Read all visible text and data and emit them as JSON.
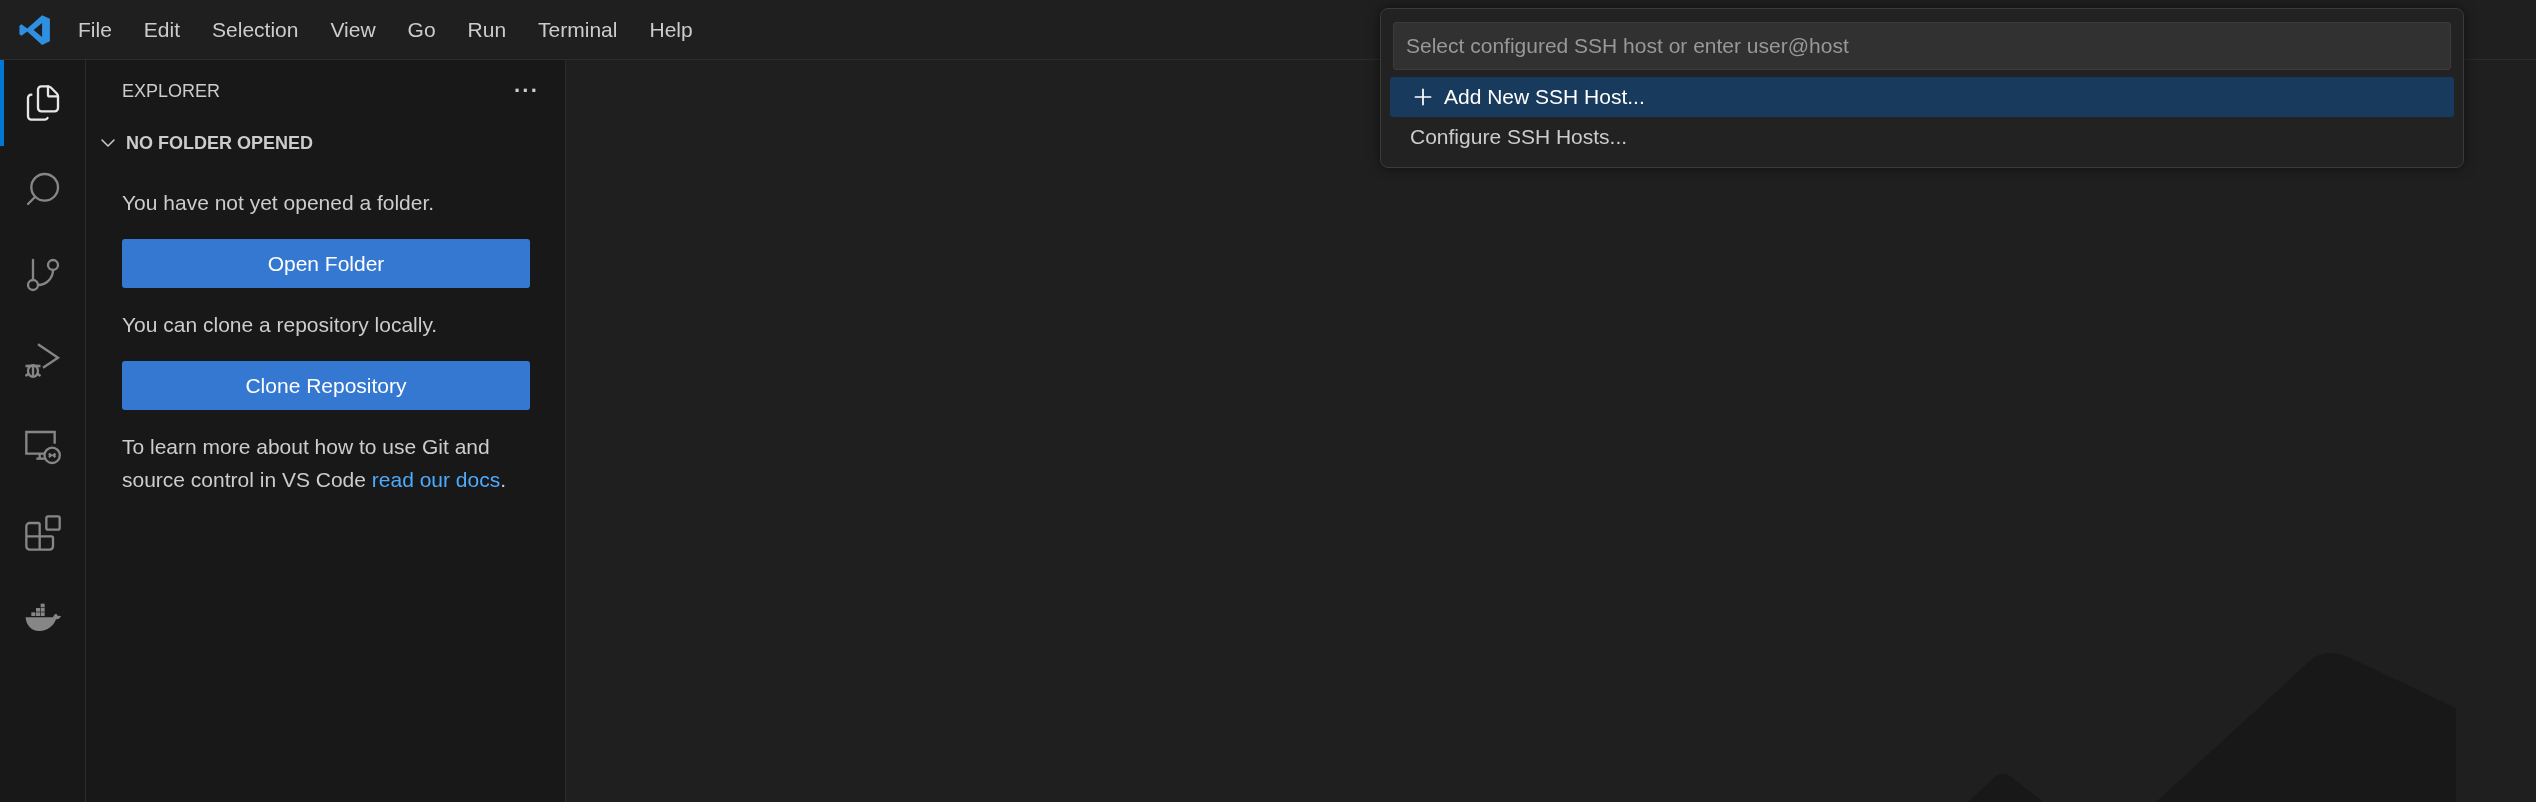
{
  "menu": [
    {
      "label": "File"
    },
    {
      "label": "Edit"
    },
    {
      "label": "Selection"
    },
    {
      "label": "View"
    },
    {
      "label": "Go"
    },
    {
      "label": "Run"
    },
    {
      "label": "Terminal"
    },
    {
      "label": "Help"
    }
  ],
  "activity_bar": [
    {
      "kind": "files",
      "selected": true
    },
    {
      "kind": "search",
      "selected": false
    },
    {
      "kind": "scm",
      "selected": false
    },
    {
      "kind": "debug",
      "selected": false
    },
    {
      "kind": "remote",
      "selected": false
    },
    {
      "kind": "extensions",
      "selected": false
    },
    {
      "kind": "docker",
      "selected": false
    }
  ],
  "sidebar": {
    "title": "EXPLORER",
    "more": "···",
    "section": {
      "title": "NO FOLDER OPENED",
      "expanded": true,
      "content": [
        {
          "kind": "text",
          "text": "You have not yet opened a folder."
        },
        {
          "kind": "button",
          "text": "Open Folder"
        },
        {
          "kind": "text",
          "text": "You can clone a repository locally."
        },
        {
          "kind": "button",
          "text": "Clone Repository"
        },
        {
          "kind": "text",
          "text": "To learn more about how to use Git and source control in VS Code ",
          "link": "read our docs",
          "after": "."
        }
      ]
    }
  },
  "quick_pick": {
    "placeholder": "Select configured SSH host or enter user@host",
    "items": [
      {
        "label": "Add New SSH Host...",
        "kind": "add",
        "selected": true
      },
      {
        "label": "Configure SSH Hosts...",
        "kind": "plain",
        "selected": false
      }
    ]
  }
}
